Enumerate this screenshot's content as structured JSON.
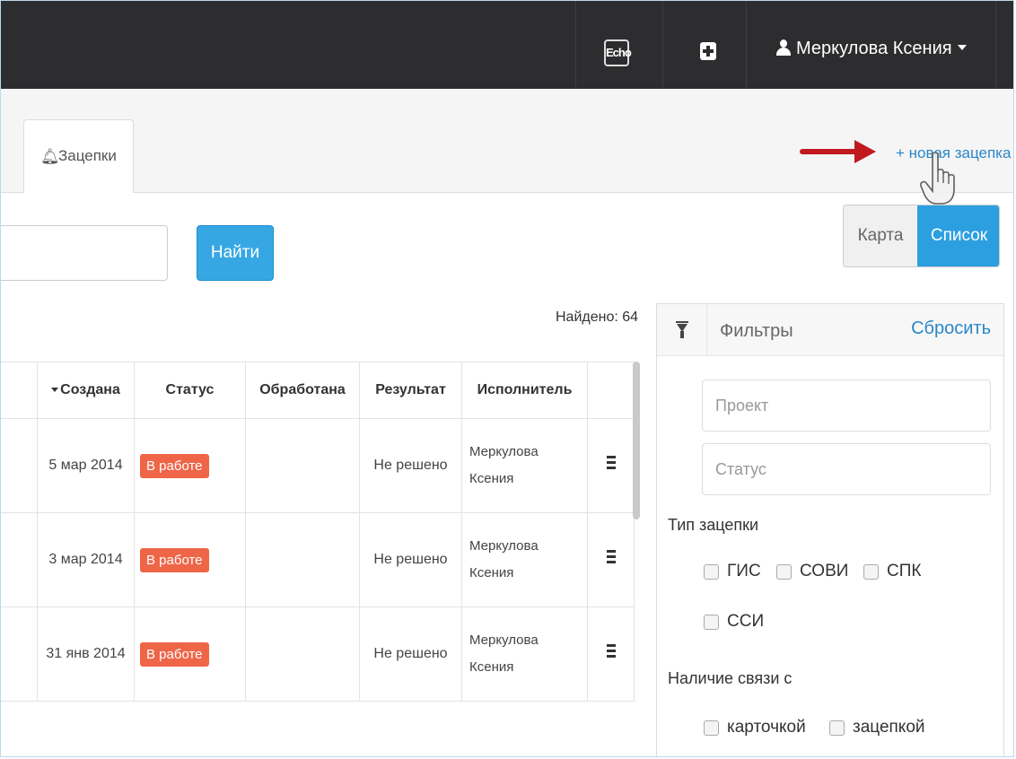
{
  "topbar": {
    "echo_label": "Echo",
    "user_name": "Меркулова Ксения"
  },
  "tabs": {
    "active_label": "Зацепки"
  },
  "actions": {
    "new_link": "+ новая зацепка",
    "find_button": "Найти",
    "search_value": ""
  },
  "view_toggle": {
    "map_label": "Карта",
    "list_label": "Список",
    "active": "Список"
  },
  "results": {
    "found_label": "Найдено: 64"
  },
  "table": {
    "headers": {
      "created": "Создана",
      "status": "Статус",
      "processed": "Обработана",
      "result": "Результат",
      "executor": "Исполнитель"
    },
    "rows": [
      {
        "created": "5 мар 2014",
        "status": "В работе",
        "processed": "",
        "result": "Не решено",
        "executor_line1": "Меркулова",
        "executor_line2": "Ксения"
      },
      {
        "created": "3 мар 2014",
        "status": "В работе",
        "processed": "",
        "result": "Не решено",
        "executor_line1": "Меркулова",
        "executor_line2": "Ксения"
      },
      {
        "created": "31 янв 2014",
        "status": "В работе",
        "processed": "",
        "result": "Не решено",
        "executor_line1": "Меркулова",
        "executor_line2": "Ксения"
      }
    ]
  },
  "filters": {
    "title": "Фильтры",
    "reset": "Сбросить",
    "project_placeholder": "Проект",
    "status_placeholder": "Статус",
    "type_label": "Тип зацепки",
    "type_options": [
      "ГИС",
      "СОВИ",
      "СПК",
      "ССИ"
    ],
    "link_label": "Наличие связи с",
    "link_options": [
      "карточкой",
      "зацепкой"
    ]
  },
  "colors": {
    "topbar": "#2d2d2f",
    "accent": "#2c9fe0",
    "status_badge": "#ef6548",
    "annotation_arrow": "#c0191e"
  }
}
